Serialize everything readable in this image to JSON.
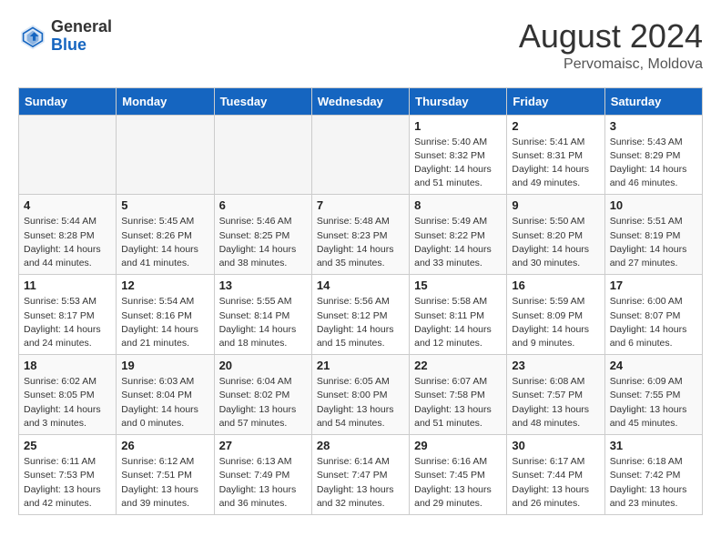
{
  "header": {
    "logo_general": "General",
    "logo_blue": "Blue",
    "month_year": "August 2024",
    "location": "Pervomaisc, Moldova"
  },
  "weekdays": [
    "Sunday",
    "Monday",
    "Tuesday",
    "Wednesday",
    "Thursday",
    "Friday",
    "Saturday"
  ],
  "weeks": [
    [
      {
        "day": "",
        "empty": true
      },
      {
        "day": "",
        "empty": true
      },
      {
        "day": "",
        "empty": true
      },
      {
        "day": "",
        "empty": true
      },
      {
        "day": "1",
        "sunrise": "Sunrise: 5:40 AM",
        "sunset": "Sunset: 8:32 PM",
        "daylight": "Daylight: 14 hours and 51 minutes."
      },
      {
        "day": "2",
        "sunrise": "Sunrise: 5:41 AM",
        "sunset": "Sunset: 8:31 PM",
        "daylight": "Daylight: 14 hours and 49 minutes."
      },
      {
        "day": "3",
        "sunrise": "Sunrise: 5:43 AM",
        "sunset": "Sunset: 8:29 PM",
        "daylight": "Daylight: 14 hours and 46 minutes."
      }
    ],
    [
      {
        "day": "4",
        "sunrise": "Sunrise: 5:44 AM",
        "sunset": "Sunset: 8:28 PM",
        "daylight": "Daylight: 14 hours and 44 minutes."
      },
      {
        "day": "5",
        "sunrise": "Sunrise: 5:45 AM",
        "sunset": "Sunset: 8:26 PM",
        "daylight": "Daylight: 14 hours and 41 minutes."
      },
      {
        "day": "6",
        "sunrise": "Sunrise: 5:46 AM",
        "sunset": "Sunset: 8:25 PM",
        "daylight": "Daylight: 14 hours and 38 minutes."
      },
      {
        "day": "7",
        "sunrise": "Sunrise: 5:48 AM",
        "sunset": "Sunset: 8:23 PM",
        "daylight": "Daylight: 14 hours and 35 minutes."
      },
      {
        "day": "8",
        "sunrise": "Sunrise: 5:49 AM",
        "sunset": "Sunset: 8:22 PM",
        "daylight": "Daylight: 14 hours and 33 minutes."
      },
      {
        "day": "9",
        "sunrise": "Sunrise: 5:50 AM",
        "sunset": "Sunset: 8:20 PM",
        "daylight": "Daylight: 14 hours and 30 minutes."
      },
      {
        "day": "10",
        "sunrise": "Sunrise: 5:51 AM",
        "sunset": "Sunset: 8:19 PM",
        "daylight": "Daylight: 14 hours and 27 minutes."
      }
    ],
    [
      {
        "day": "11",
        "sunrise": "Sunrise: 5:53 AM",
        "sunset": "Sunset: 8:17 PM",
        "daylight": "Daylight: 14 hours and 24 minutes."
      },
      {
        "day": "12",
        "sunrise": "Sunrise: 5:54 AM",
        "sunset": "Sunset: 8:16 PM",
        "daylight": "Daylight: 14 hours and 21 minutes."
      },
      {
        "day": "13",
        "sunrise": "Sunrise: 5:55 AM",
        "sunset": "Sunset: 8:14 PM",
        "daylight": "Daylight: 14 hours and 18 minutes."
      },
      {
        "day": "14",
        "sunrise": "Sunrise: 5:56 AM",
        "sunset": "Sunset: 8:12 PM",
        "daylight": "Daylight: 14 hours and 15 minutes."
      },
      {
        "day": "15",
        "sunrise": "Sunrise: 5:58 AM",
        "sunset": "Sunset: 8:11 PM",
        "daylight": "Daylight: 14 hours and 12 minutes."
      },
      {
        "day": "16",
        "sunrise": "Sunrise: 5:59 AM",
        "sunset": "Sunset: 8:09 PM",
        "daylight": "Daylight: 14 hours and 9 minutes."
      },
      {
        "day": "17",
        "sunrise": "Sunrise: 6:00 AM",
        "sunset": "Sunset: 8:07 PM",
        "daylight": "Daylight: 14 hours and 6 minutes."
      }
    ],
    [
      {
        "day": "18",
        "sunrise": "Sunrise: 6:02 AM",
        "sunset": "Sunset: 8:05 PM",
        "daylight": "Daylight: 14 hours and 3 minutes."
      },
      {
        "day": "19",
        "sunrise": "Sunrise: 6:03 AM",
        "sunset": "Sunset: 8:04 PM",
        "daylight": "Daylight: 14 hours and 0 minutes."
      },
      {
        "day": "20",
        "sunrise": "Sunrise: 6:04 AM",
        "sunset": "Sunset: 8:02 PM",
        "daylight": "Daylight: 13 hours and 57 minutes."
      },
      {
        "day": "21",
        "sunrise": "Sunrise: 6:05 AM",
        "sunset": "Sunset: 8:00 PM",
        "daylight": "Daylight: 13 hours and 54 minutes."
      },
      {
        "day": "22",
        "sunrise": "Sunrise: 6:07 AM",
        "sunset": "Sunset: 7:58 PM",
        "daylight": "Daylight: 13 hours and 51 minutes."
      },
      {
        "day": "23",
        "sunrise": "Sunrise: 6:08 AM",
        "sunset": "Sunset: 7:57 PM",
        "daylight": "Daylight: 13 hours and 48 minutes."
      },
      {
        "day": "24",
        "sunrise": "Sunrise: 6:09 AM",
        "sunset": "Sunset: 7:55 PM",
        "daylight": "Daylight: 13 hours and 45 minutes."
      }
    ],
    [
      {
        "day": "25",
        "sunrise": "Sunrise: 6:11 AM",
        "sunset": "Sunset: 7:53 PM",
        "daylight": "Daylight: 13 hours and 42 minutes."
      },
      {
        "day": "26",
        "sunrise": "Sunrise: 6:12 AM",
        "sunset": "Sunset: 7:51 PM",
        "daylight": "Daylight: 13 hours and 39 minutes."
      },
      {
        "day": "27",
        "sunrise": "Sunrise: 6:13 AM",
        "sunset": "Sunset: 7:49 PM",
        "daylight": "Daylight: 13 hours and 36 minutes."
      },
      {
        "day": "28",
        "sunrise": "Sunrise: 6:14 AM",
        "sunset": "Sunset: 7:47 PM",
        "daylight": "Daylight: 13 hours and 32 minutes."
      },
      {
        "day": "29",
        "sunrise": "Sunrise: 6:16 AM",
        "sunset": "Sunset: 7:45 PM",
        "daylight": "Daylight: 13 hours and 29 minutes."
      },
      {
        "day": "30",
        "sunrise": "Sunrise: 6:17 AM",
        "sunset": "Sunset: 7:44 PM",
        "daylight": "Daylight: 13 hours and 26 minutes."
      },
      {
        "day": "31",
        "sunrise": "Sunrise: 6:18 AM",
        "sunset": "Sunset: 7:42 PM",
        "daylight": "Daylight: 13 hours and 23 minutes."
      }
    ]
  ]
}
